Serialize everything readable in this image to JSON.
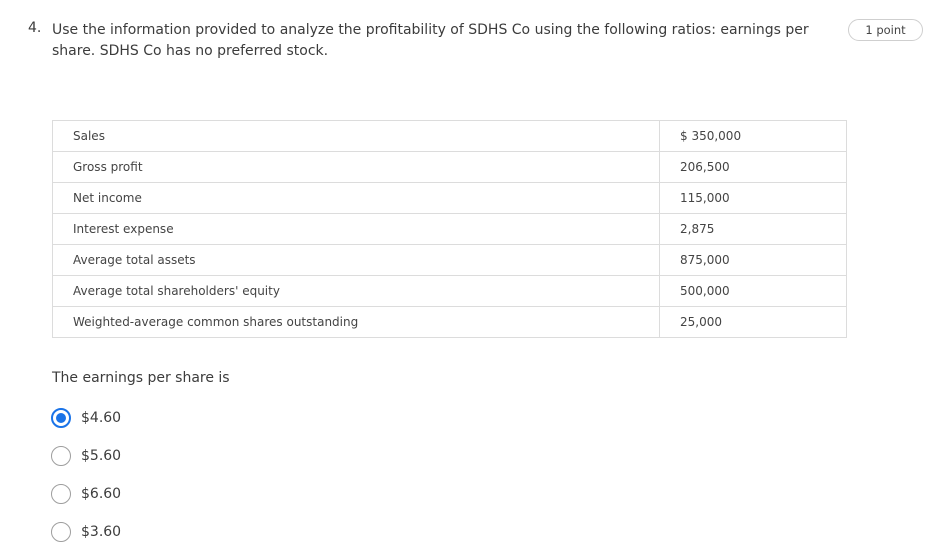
{
  "question": {
    "number": "4.",
    "text": "Use the information provided to analyze the profitability of SDHS Co using the following ratios: earnings per share. SDHS Co has no preferred stock.",
    "points": "1 point"
  },
  "table": {
    "rows": [
      {
        "label": "Sales",
        "value": "$ 350,000"
      },
      {
        "label": "Gross profit",
        "value": "206,500"
      },
      {
        "label": "Net income",
        "value": "115,000"
      },
      {
        "label": "Interest expense",
        "value": "2,875"
      },
      {
        "label": "Average total assets",
        "value": "875,000"
      },
      {
        "label": "Average total shareholders' equity",
        "value": "500,000"
      },
      {
        "label": "Weighted-average common shares outstanding",
        "value": "25,000"
      }
    ]
  },
  "prompt": "The earnings per share is",
  "options": [
    {
      "label": "$4.60",
      "selected": true
    },
    {
      "label": "$5.60",
      "selected": false
    },
    {
      "label": "$6.60",
      "selected": false
    },
    {
      "label": "$3.60",
      "selected": false
    }
  ]
}
